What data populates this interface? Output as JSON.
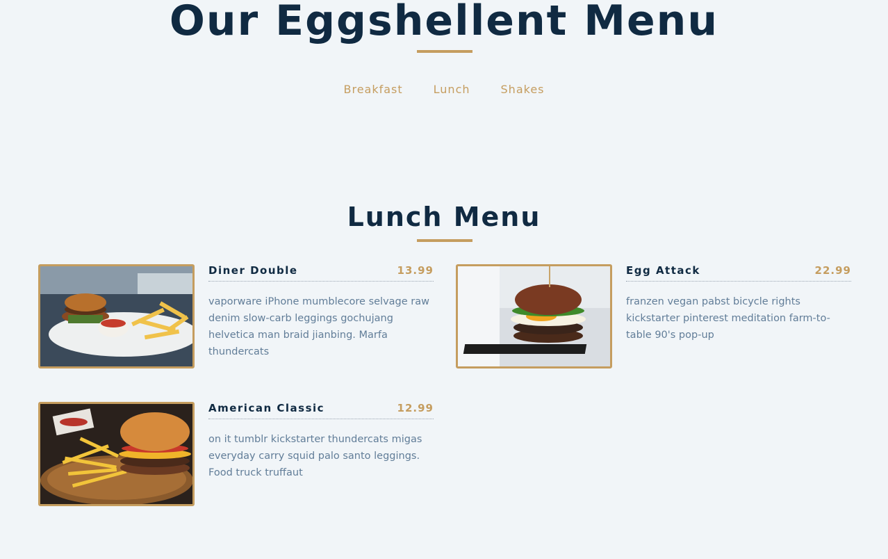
{
  "header": {
    "title": "Our Eggshellent Menu"
  },
  "tabs": [
    {
      "label": "Breakfast"
    },
    {
      "label": "Lunch"
    },
    {
      "label": "Shakes"
    }
  ],
  "section": {
    "title": "Lunch Menu"
  },
  "items": [
    {
      "name": "Diner Double",
      "price": "13.99",
      "description": "vaporware iPhone mumblecore selvage raw denim slow-carb leggings gochujang helvetica man braid jianbing. Marfa thundercats",
      "image": "burger-with-fries-photo"
    },
    {
      "name": "Egg Attack",
      "price": "22.99",
      "description": "franzen vegan pabst bicycle rights kickstarter pinterest meditation farm-to-table 90's pop-up",
      "image": "burger-with-egg-photo"
    },
    {
      "name": "American Classic",
      "price": "12.99",
      "description": "on it tumblr kickstarter thundercats migas everyday carry squid palo santo leggings. Food truck truffaut",
      "image": "classic-burger-fries-photo"
    }
  ],
  "colors": {
    "background": "#f1f5f8",
    "primary_dark": "#102a42",
    "accent_gold": "#c59d5f",
    "text_muted": "#617d98"
  }
}
